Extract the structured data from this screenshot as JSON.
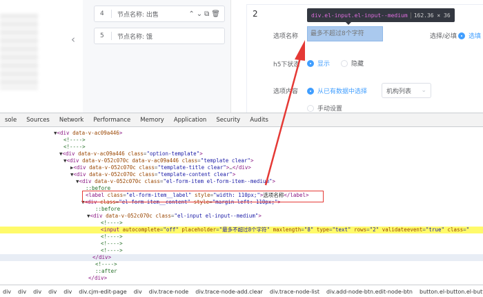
{
  "nodes": [
    {
      "index": "4",
      "label": "节点名称: 出售"
    },
    {
      "index": "5",
      "label": "节点名称: 饿"
    }
  ],
  "step_number": "2",
  "form": {
    "option_name_label": "选项名称",
    "option_name_placeholder": "最多不超过8个字符",
    "required_label": "选择/必填",
    "required_option": "选填",
    "h5_status_label": "h5下状态",
    "show_option": "显示",
    "hide_option": "隐藏",
    "option_content_label": "选项内容",
    "from_data_option": "从已有数据中选择",
    "select_value": "机构列表",
    "manual_option": "手动设置"
  },
  "tooltip": {
    "selector": "div.el-input.el-input--medium",
    "size": "162.36 × 36"
  },
  "devtools": {
    "tabs": [
      "sole",
      "Sources",
      "Network",
      "Performance",
      "Memory",
      "Application",
      "Security",
      "Audits"
    ],
    "lines": [
      {
        "indent": 78,
        "html": "<span class='tri'>▼</span><span class='tag'>&lt;div</span> <span class='attr'>data-v-ac09a446</span><span class='tag'>&gt;</span>"
      },
      {
        "indent": 92,
        "html": "<span class='cmt'>&lt;!----&gt;</span>"
      },
      {
        "indent": 92,
        "html": "<span class='cmt'>&lt;!----&gt;</span>"
      },
      {
        "indent": 86,
        "html": "<span class='tri'>▼</span><span class='tag'>&lt;div</span> <span class='attr'>data-v-ac09a446</span> <span class='attr'>class</span>=<span class='val'>\"option-template\"</span><span class='tag'>&gt;</span>"
      },
      {
        "indent": 92,
        "html": "<span class='tri'>▼</span><span class='tag'>&lt;div</span> <span class='attr'>data-v-052c070c</span> <span class='attr'>data-v-ac09a446</span> <span class='attr'>class</span>=<span class='val'>\"template clear\"</span><span class='tag'>&gt;</span>"
      },
      {
        "indent": 102,
        "html": "<span class='tri'>▶</span><span class='tag'>&lt;div</span> <span class='attr'>data-v-052c070c</span> <span class='attr'>class</span>=<span class='val'>\"template-title clear\"</span><span class='tag'>&gt;</span>…<span class='tag'>&lt;/div&gt;</span>"
      },
      {
        "indent": 102,
        "html": "<span class='tri'>▼</span><span class='tag'>&lt;div</span> <span class='attr'>data-v-052c070c</span> <span class='attr'>class</span>=<span class='val'>\"template-content clear\"</span><span class='tag'>&gt;</span>"
      },
      {
        "indent": 110,
        "html": "<span class='tri'>▼</span><span class='tag'>&lt;div</span> <span class='attr'>data-v-052c070c</span> <span class='attr'>class</span>=<span class='val'>\"el-form-item el-form-item--medium\"</span><span class='tag'>&gt;</span>"
      },
      {
        "indent": 124,
        "html": "<span class='cmt'>::before</span>"
      },
      {
        "indent": 124,
        "html": "<span class='tag'>&lt;label</span> <span class='attr'>class</span>=<span class='val'>\"el-form-item__label\"</span> <span class='attr'>style</span>=<span class='val'>\"width: 110px;\"</span><span class='tag'>&gt;</span><span class='txt'>选项名称</span><span class='tag'>&lt;/label&gt;</span>"
      },
      {
        "indent": 118,
        "html": "<span class='tri'>▼</span><span class='tag'>&lt;div</span> <span class='attr'>class</span>=<span class='val'>\"el-form-item__content\"</span> <span class='attr'>style</span>=<span class='val'>\"margin-left: 110px;\"</span><span class='tag'>&gt;</span>"
      },
      {
        "indent": 138,
        "html": "<span class='cmt'>::before</span>"
      },
      {
        "indent": 126,
        "html": "<span class='tri'>▼</span><span class='tag'>&lt;div</span> <span class='attr'>data-v-052c070c</span> <span class='attr'>class</span>=<span class='val'>\"el-input el-input--medium\"</span><span class='tag'>&gt;</span>"
      },
      {
        "indent": 146,
        "html": "<span class='cmt'>&lt;!----&gt;</span>"
      },
      {
        "indent": 146,
        "hl": true,
        "html": "<span class='tag'>&lt;input</span> <span class='attr'>autocomplete</span>=<span class='val'>\"off\"</span> <span class='attr'>placeholder</span>=<span class='val'>\"最多不超过8个字符\"</span> <span class='attr'>maxlength</span>=<span class='val'>\"8\"</span> <span class='attr'>type</span>=<span class='val'>\"text\"</span> <span class='attr'>rows</span>=<span class='val'>\"2\"</span> <span class='attr'>validateevent</span>=<span class='val'>\"true\"</span> <span class='attr'>class</span>=<span class='val'>\"</span>"
      },
      {
        "indent": 146,
        "html": "<span class='cmt'>&lt;!----&gt;</span>"
      },
      {
        "indent": 146,
        "html": "<span class='cmt'>&lt;!----&gt;</span>"
      },
      {
        "indent": 146,
        "html": "<span class='cmt'>&lt;!----&gt;</span>"
      },
      {
        "indent": 134,
        "sel": true,
        "html": "<span class='tag'>&lt;/div&gt;</span>"
      },
      {
        "indent": 138,
        "html": "<span class='cmt'>&lt;!----&gt;</span>"
      },
      {
        "indent": 138,
        "html": "<span class='cmt'>::after</span>"
      },
      {
        "indent": 128,
        "html": "<span class='tag'>&lt;/div&gt;</span>"
      }
    ],
    "breadcrumbs": [
      "div",
      "div",
      "div",
      "div",
      "div",
      "div.cjm-edit-page",
      "div",
      "div.trace-node",
      "div.trace-node-add.clear",
      "div.trace-node-list",
      "div.add-node-btn.edit-node-btn",
      "button.el-button.el-button--primary.el-"
    ]
  }
}
